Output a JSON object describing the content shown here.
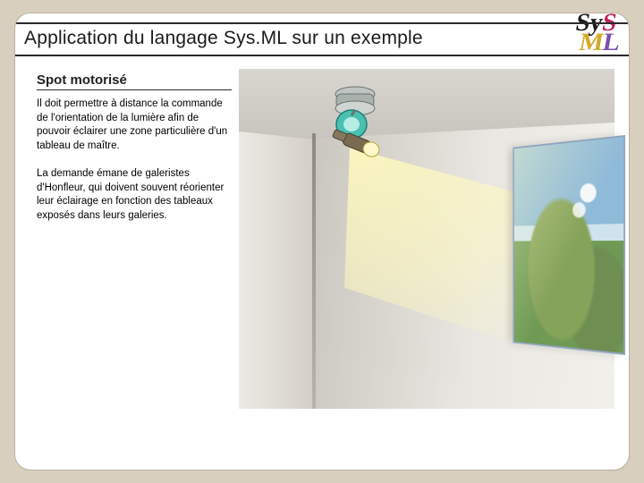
{
  "header": {
    "title": "Application du langage Sys.ML sur un exemple"
  },
  "logo": {
    "line1a": "Sy",
    "line1b": "S",
    "line2a": "M",
    "line2b": "L"
  },
  "section": {
    "subtitle": "Spot motorisé",
    "paragraph1": "Il doit permettre à distance la commande de l'orientation de la lumière afin de pouvoir éclairer une zone particulière d'un tableau de maître.",
    "paragraph2": "La demande émane de galeristes d'Honfleur, qui doivent souvent réorienter leur éclairage en fonction des tableaux exposés dans leurs galeries."
  }
}
